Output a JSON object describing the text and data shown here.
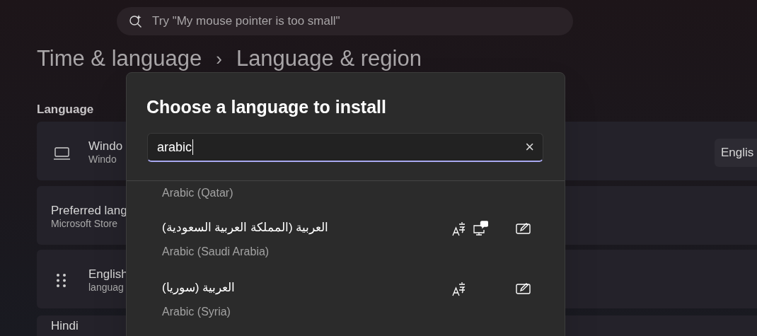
{
  "search": {
    "placeholder": "Try \"My mouse pointer is too small\""
  },
  "breadcrumb": [
    "Time & language",
    "›",
    "Language & region"
  ],
  "section_title": "Language",
  "cards": [
    {
      "kind": "display",
      "title": "Windo",
      "subtitle": "Windo",
      "dropdown": "Englis"
    },
    {
      "kind": "plain",
      "title": "Preferred lang",
      "subtitle": "Microsoft Store"
    },
    {
      "kind": "draggable",
      "title": "English",
      "subtitle": "languag"
    },
    {
      "kind": "plain",
      "title": "Hindi"
    }
  ],
  "dialog": {
    "title": "Choose a language to install",
    "search_value": "arabic",
    "clear": "×",
    "languages": [
      {
        "english": "Arabic (Qatar)"
      },
      {
        "native": "العربية (المملكة العربية السعودية)",
        "english": "Arabic (Saudi Arabia)",
        "features": {
          "display_language": true,
          "speech": true,
          "handwriting": true
        }
      },
      {
        "native": "العربية (سوريا)",
        "english": "Arabic (Syria)",
        "features": {
          "display_language": true,
          "speech": false,
          "handwriting": true
        }
      }
    ]
  }
}
